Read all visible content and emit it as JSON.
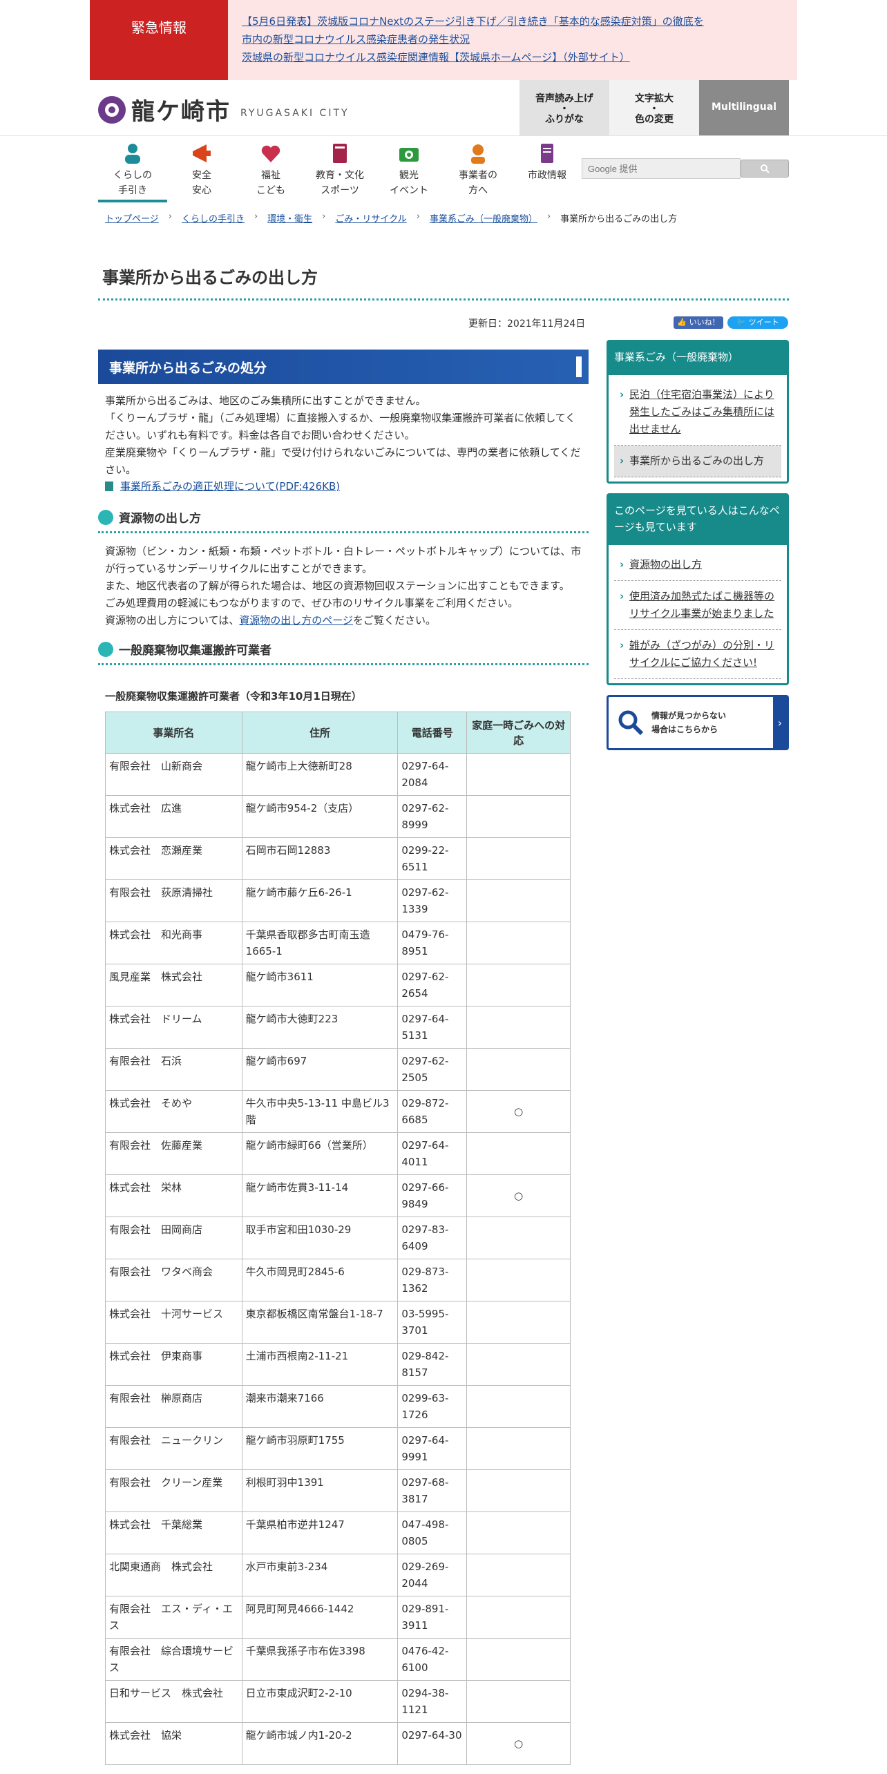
{
  "emergency": {
    "label": "緊急情報",
    "links": [
      "【5月6日発表】茨城版コロナNextのステージ引き下げ／引き続き「基本的な感染症対策」の徹底を",
      "市内の新型コロナウイルス感染症患者の発生状況",
      "茨城県の新型コロナウイルス感染症関連情報【茨城県ホームページ】（外部サイト）"
    ]
  },
  "header": {
    "logo_jp": "龍ケ崎市",
    "logo_en": "RYUGASAKI CITY",
    "voice_label_1": "音声読み上げ",
    "voice_label_2": "・",
    "voice_label_3": "ふりがな",
    "text_label_1": "文字拡大",
    "text_label_2": "・",
    "text_label_3": "色の変更",
    "multilingual": "Multilingual"
  },
  "nav": {
    "items": [
      {
        "l1": "くらしの",
        "l2": "手引き",
        "icon": "person-icon",
        "color": "#1d8b9a"
      },
      {
        "l1": "安全",
        "l2": "安心",
        "icon": "megaphone-icon",
        "color": "#d9441a"
      },
      {
        "l1": "福祉",
        "l2": "こども",
        "icon": "heart-hand-icon",
        "color": "#c8304e"
      },
      {
        "l1": "教育・文化",
        "l2": "スポーツ",
        "icon": "book-icon",
        "color": "#a3234a"
      },
      {
        "l1": "観光",
        "l2": "イベント",
        "icon": "camera-icon",
        "color": "#2c9a3c"
      },
      {
        "l1": "事業者の",
        "l2": "方へ",
        "icon": "worker-icon",
        "color": "#e07a1a"
      },
      {
        "l1": "市政情報",
        "l2": "",
        "icon": "document-icon",
        "color": "#7a3c8a"
      }
    ],
    "search_placeholder": "Google 提供"
  },
  "breadcrumb": [
    "トップページ",
    "くらしの手引き",
    "環境・衛生",
    "ごみ・リサイクル",
    "事業系ごみ（一般廃棄物）",
    "事業所から出るごみの出し方"
  ],
  "page": {
    "title": "事業所から出るごみの出し方",
    "updated": "更新日：2021年11月24日",
    "like": "いいね！",
    "tweet": "ツイート"
  },
  "section1": {
    "heading": "事業所から出るごみの処分",
    "p1": "事業所から出るごみは、地区のごみ集積所に出すことができません。",
    "p2": "「くりーんプラザ・龍」（ごみ処理場）に直接搬入するか、一般廃棄物収集運搬許可業者に依頼してください。いずれも有料です。料金は各自でお問い合わせください。",
    "p3": "産業廃棄物や「くりーんプラザ・龍」で受け付けられないごみについては、専門の業者に依頼してください。",
    "pdf_link": "事業所系ごみの適正処理について(PDF:426KB)"
  },
  "section2": {
    "heading": "資源物の出し方",
    "p1": "資源物（ビン・カン・紙類・布類・ペットボトル・白トレー・ペットボトルキャップ）については、市が行っているサンデーリサイクルに出すことができます。",
    "p2": "また、地区代表者の了解が得られた場合は、地区の資源物回収ステーションに出すこともできます。",
    "p3": "ごみ処理費用の軽減にもつながりますので、ぜひ市のリサイクル事業をご利用ください。",
    "p4_pre": "資源物の出し方については、",
    "p4_link": "資源物の出し方のページ",
    "p4_post": "をご覧ください。"
  },
  "section3": {
    "heading": "一般廃棄物収集運搬許可業者",
    "caption": "一般廃棄物収集運搬許可業者（令和3年10月1日現在）",
    "columns": [
      "事業所名",
      "住所",
      "電話番号",
      "家庭一時ごみへの対応"
    ],
    "rows": [
      [
        "有限会社　山新商会",
        "龍ケ崎市上大徳新町28",
        "0297-64-2084",
        ""
      ],
      [
        "株式会社　広進",
        "龍ケ崎市954-2（支店）",
        "0297-62-8999",
        ""
      ],
      [
        "株式会社　恋瀬産業",
        "石岡市石岡12883",
        "0299-22-6511",
        ""
      ],
      [
        "有限会社　荻原清掃社",
        "龍ケ崎市藤ケ丘6-26-1",
        "0297-62-1339",
        ""
      ],
      [
        "株式会社　和光商事",
        "千葉県香取郡多古町南玉造1665-1",
        "0479-76-8951",
        ""
      ],
      [
        "風見産業　株式会社",
        "龍ケ崎市3611",
        "0297-62-2654",
        ""
      ],
      [
        "株式会社　ドリーム",
        "龍ケ崎市大徳町223",
        "0297-64-5131",
        ""
      ],
      [
        "有限会社　石浜",
        "龍ケ崎市697",
        "0297-62-2505",
        ""
      ],
      [
        "株式会社　そめや",
        "牛久市中央5-13-11 中島ビル3階",
        "029-872-6685",
        "○"
      ],
      [
        "有限会社　佐藤産業",
        "龍ケ崎市緑町66（営業所）",
        "0297-64-4011",
        ""
      ],
      [
        "株式会社　栄林",
        "龍ケ崎市佐貫3-11-14",
        "0297-66-9849",
        "○"
      ],
      [
        "有限会社　田岡商店",
        "取手市宮和田1030-29",
        "0297-83-6409",
        ""
      ],
      [
        "有限会社　ワタベ商会",
        "牛久市岡見町2845-6",
        "029-873-1362",
        ""
      ],
      [
        "株式会社　十河サービス",
        "東京都板橋区南常盤台1-18-7",
        "03-5995-3701",
        ""
      ],
      [
        "株式会社　伊東商事",
        "土浦市西根南2-11-21",
        "029-842-8157",
        ""
      ],
      [
        "有限会社　榊原商店",
        "潮来市潮来7166",
        "0299-63-1726",
        ""
      ],
      [
        "有限会社　ニュークリン",
        "龍ケ崎市羽原町1755",
        "0297-64-9991",
        ""
      ],
      [
        "有限会社　クリーン産業",
        "利根町羽中1391",
        "0297-68-3817",
        ""
      ],
      [
        "株式会社　千葉総業",
        "千葉県柏市逆井1247",
        "047-498-0805",
        ""
      ],
      [
        "北関東通商　株式会社",
        "水戸市東前3-234",
        "029-269-2044",
        ""
      ],
      [
        "有限会社　エス・ディ・エス",
        "阿見町阿見4666-1442",
        "029-891-3911",
        ""
      ],
      [
        "有限会社　綜合環境サービス",
        "千葉県我孫子市布佐3398",
        "0476-42-6100",
        ""
      ],
      [
        "日和サービス　株式会社",
        "日立市東成沢町2-2-10",
        "0294-38-1121",
        ""
      ],
      [
        "株式会社　協栄",
        "龍ケ崎市城ノ内1-20-2",
        "0297-64-30",
        "○"
      ]
    ]
  },
  "sidebar": {
    "box1_head": "事業系ごみ（一般廃棄物）",
    "box1_items": [
      "民泊（住宅宿泊事業法）により発生したごみはごみ集積所には出せません",
      "事業所から出るごみの出し方"
    ],
    "box2_head": "このページを見ている人はこんなページも見ています",
    "box2_items": [
      "資源物の出し方",
      "使用済み加熱式たばこ機器等のリサイクル事業が始まりました",
      "雑がみ（ざつがみ）の分別・リサイクルにご協力ください!"
    ],
    "notfound_1": "情報が見つからない",
    "notfound_2": "場合はこちらから"
  }
}
